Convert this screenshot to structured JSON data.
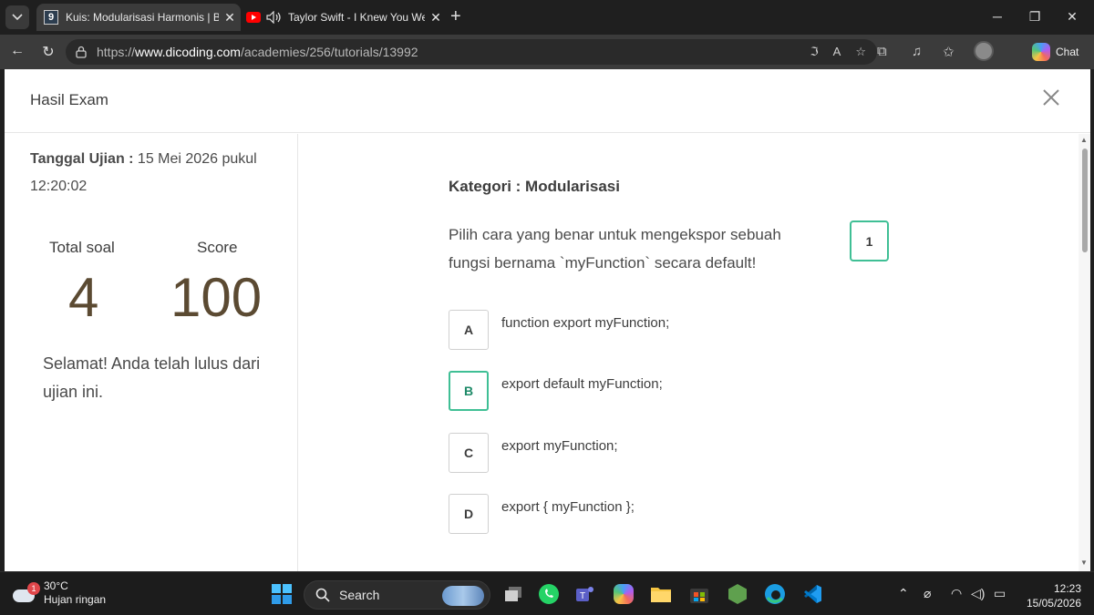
{
  "browser": {
    "tab_count": "9",
    "tabs": [
      {
        "title": "Kuis: Modularisasi Harmonis | Belajar",
        "close": "✕"
      },
      {
        "title": "Taylor Swift - I Knew You Were Trouble",
        "close": "✕"
      }
    ],
    "new_tab": "+",
    "url_prefix": "https://",
    "url_host": "www.dicoding.com",
    "url_path": "/academies/256/tutorials/13992",
    "chat_label": "Chat"
  },
  "modal": {
    "title": "Hasil Exam",
    "close": "✕"
  },
  "summary": {
    "date_label": "Tanggal Ujian :",
    "date_value": " 15 Mei 2026 pukul 12:20:02",
    "total_label": "Total soal",
    "total_value": "4",
    "score_label": "Score",
    "score_value": "100",
    "message": "Selamat! Anda telah lulus dari ujian ini."
  },
  "question": {
    "category": "Kategori : Modularisasi",
    "text": "Pilih cara yang benar untuk mengekspor sebuah fungsi bernama `myFunction` secara default!",
    "number": "1",
    "options": [
      {
        "letter": "A",
        "text": "function export myFunction;"
      },
      {
        "letter": "B",
        "text": "export default myFunction;"
      },
      {
        "letter": "C",
        "text": "export myFunction;"
      },
      {
        "letter": "D",
        "text": "export { myFunction };"
      }
    ],
    "correct_letter": "B"
  },
  "taskbar": {
    "weather_alert": "1",
    "temperature": "30°C",
    "condition": "Hujan ringan",
    "search_label": "Search",
    "time": "12:23",
    "date": "15/05/2026"
  },
  "colors": {
    "accent_green": "#3fbf95",
    "score_brown": "#5b4a32"
  }
}
